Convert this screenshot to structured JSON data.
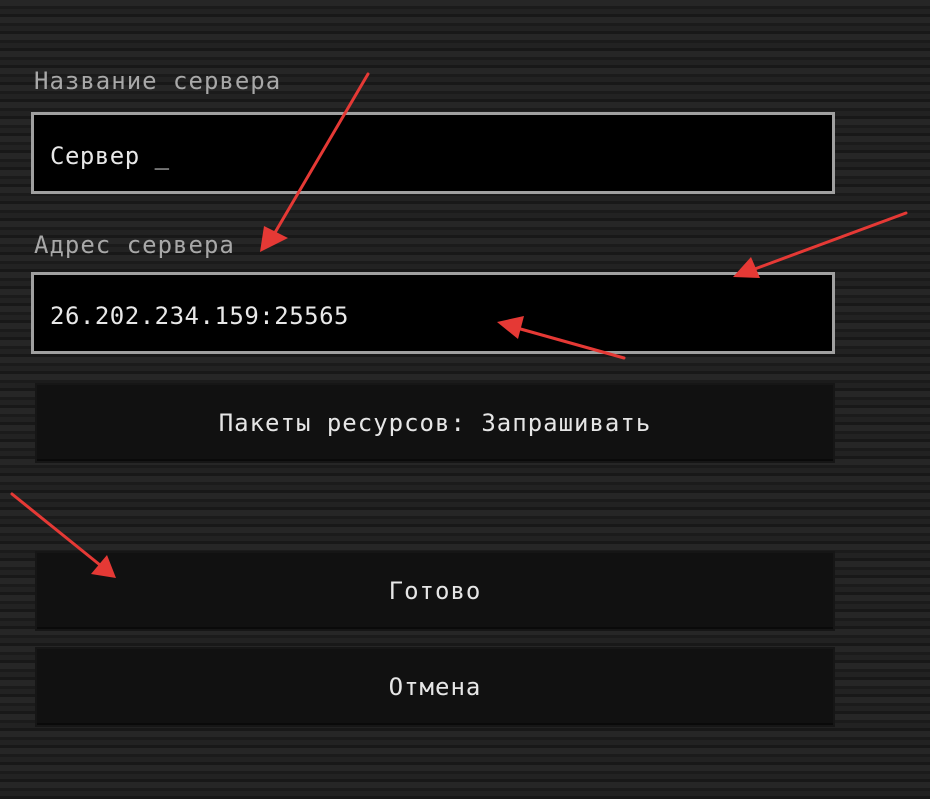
{
  "form": {
    "server_name_label": "Название сервера",
    "server_name_value": "Сервер _",
    "server_address_label": "Адрес сервера",
    "server_address_value": "26.202.234.159:25565"
  },
  "buttons": {
    "resource_packs": "Пакеты ресурсов: Запрашивать",
    "done": "Готово",
    "cancel": "Отмена"
  },
  "annotations": {
    "arrow_color": "#e53935"
  }
}
